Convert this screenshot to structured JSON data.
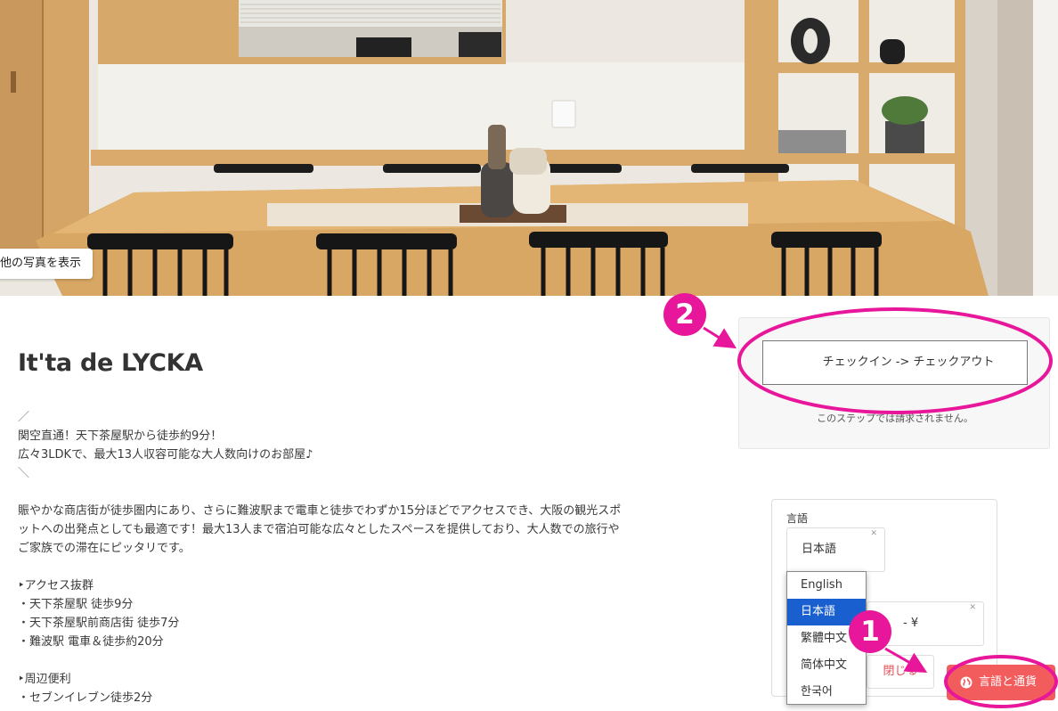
{
  "hero": {
    "more_photos_label": "他の写真を表示"
  },
  "listing": {
    "title": "It'ta de LYCKA",
    "description_lines": [
      "／",
      "関空直通！天下茶屋駅から徒歩約9分！",
      "広々3LDKで、最大13人収容可能な大人数向けのお部屋♪",
      "＼",
      "",
      "賑やかな商店街が徒歩圏内にあり、さらに難波駅まで電車と徒歩でわずか15分ほどでアクセスでき、大阪の観光スポ",
      "ットへの出発点としても最適です！最大13人まで宿泊可能な広々としたスペースを提供しており、大人数での旅行や",
      "ご家族での滞在にピッタリです。",
      "",
      "‣アクセス抜群",
      "・天下茶屋駅 徒歩9分",
      "・天下茶屋駅前商店街 徒歩7分",
      "・難波駅 電車＆徒歩約20分",
      "",
      "‣周辺便利",
      "・セブンイレブン徒歩2分"
    ]
  },
  "booking": {
    "date_button_label": "チェックイン -> チェックアウト",
    "no_charge_note": "このステップでは請求されません。"
  },
  "settings": {
    "language_label": "言語",
    "selected_language": "日本語",
    "currency_value": "- ¥",
    "close_label": "閉じる",
    "language_options": [
      "English",
      "日本語",
      "繁體中文",
      "简体中文",
      "한국어"
    ],
    "selected_index": 1,
    "toggle_button_label": "言語と通貨"
  },
  "annotations": {
    "badge_1": "1",
    "badge_2": "2",
    "highlight_color": "#e8169a"
  }
}
